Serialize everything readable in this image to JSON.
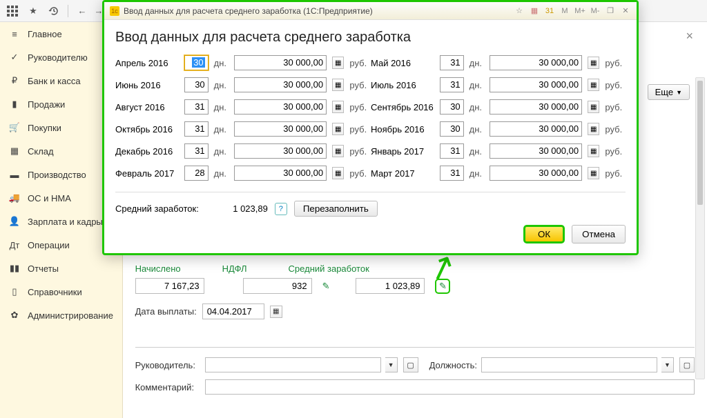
{
  "topbar": {
    "title": ""
  },
  "sidebar": {
    "items": [
      {
        "label": "Главное",
        "icon": "home"
      },
      {
        "label": "Руководителю",
        "icon": "chart-line"
      },
      {
        "label": "Банк и касса",
        "icon": "ruble"
      },
      {
        "label": "Продажи",
        "icon": "bag"
      },
      {
        "label": "Покупки",
        "icon": "cart"
      },
      {
        "label": "Склад",
        "icon": "boxes"
      },
      {
        "label": "Производство",
        "icon": "factory"
      },
      {
        "label": "ОС и НМА",
        "icon": "truck"
      },
      {
        "label": "Зарплата и кадры",
        "icon": "person"
      },
      {
        "label": "Операции",
        "icon": "ops"
      },
      {
        "label": "Отчеты",
        "icon": "bars"
      },
      {
        "label": "Справочники",
        "icon": "book"
      },
      {
        "label": "Администрирование",
        "icon": "gear"
      }
    ]
  },
  "content": {
    "more_button": "Еще",
    "tabs": {
      "accrued": "Начислено",
      "ndfl": "НДФЛ",
      "avg": "Средний заработок"
    },
    "values": {
      "accrued": "7 167,23",
      "ndfl": "932",
      "avg": "1 023,89"
    },
    "payment_date_label": "Дата выплаты:",
    "payment_date": "04.04.2017",
    "manager_label": "Руководитель:",
    "position_label": "Должность:",
    "comment_label": "Комментарий:"
  },
  "dialog": {
    "window_title": "Ввод данных для расчета среднего заработка  (1С:Предприятие)",
    "title": "Ввод данных для расчета среднего заработка",
    "dn": "дн.",
    "rub": "руб.",
    "rows": [
      {
        "l": {
          "label": "Апрель 2016",
          "days": "30",
          "amount": "30 000,00",
          "sel": true
        },
        "r": {
          "label": "Май 2016",
          "days": "31",
          "amount": "30 000,00"
        }
      },
      {
        "l": {
          "label": "Июнь 2016",
          "days": "30",
          "amount": "30 000,00"
        },
        "r": {
          "label": "Июль 2016",
          "days": "31",
          "amount": "30 000,00"
        }
      },
      {
        "l": {
          "label": "Август 2016",
          "days": "31",
          "amount": "30 000,00"
        },
        "r": {
          "label": "Сентябрь 2016",
          "days": "30",
          "amount": "30 000,00"
        }
      },
      {
        "l": {
          "label": "Октябрь 2016",
          "days": "31",
          "amount": "30 000,00"
        },
        "r": {
          "label": "Ноябрь 2016",
          "days": "30",
          "amount": "30 000,00"
        }
      },
      {
        "l": {
          "label": "Декабрь 2016",
          "days": "31",
          "amount": "30 000,00"
        },
        "r": {
          "label": "Январь 2017",
          "days": "31",
          "amount": "30 000,00"
        }
      },
      {
        "l": {
          "label": "Февраль 2017",
          "days": "28",
          "amount": "30 000,00"
        },
        "r": {
          "label": "Март 2017",
          "days": "31",
          "amount": "30 000,00"
        }
      }
    ],
    "avg_label": "Средний заработок:",
    "avg_value": "1 023,89",
    "refill": "Перезаполнить",
    "ok": "ОК",
    "cancel": "Отмена",
    "tb_icons": {
      "m": "M",
      "mp": "M+",
      "mm": "M-"
    }
  }
}
